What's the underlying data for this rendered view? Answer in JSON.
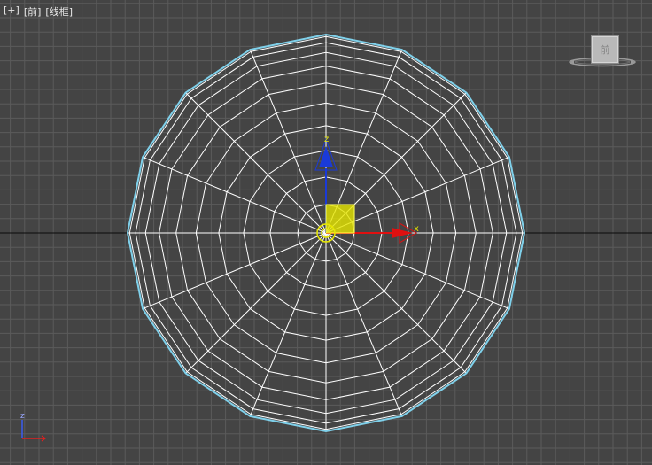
{
  "viewport": {
    "menu": {
      "plus": "[+]",
      "view": "[前]",
      "shading": "[线框]"
    },
    "viewcube": {
      "face_label": "前"
    },
    "gizmo": {
      "x_label": "x",
      "z_label": "z"
    },
    "triad": {
      "z_label": "z"
    },
    "colors": {
      "background": "#444444",
      "grid": "#5b5b5b",
      "horizon": "#0a0a0a",
      "wire": "#ffffff",
      "selection_outline": "#7fd0ea",
      "gizmo_x": "#e01010",
      "gizmo_z": "#1a3ad8",
      "gizmo_center": "#e6e600"
    },
    "mesh": {
      "sides": 16,
      "rings": 11
    }
  }
}
